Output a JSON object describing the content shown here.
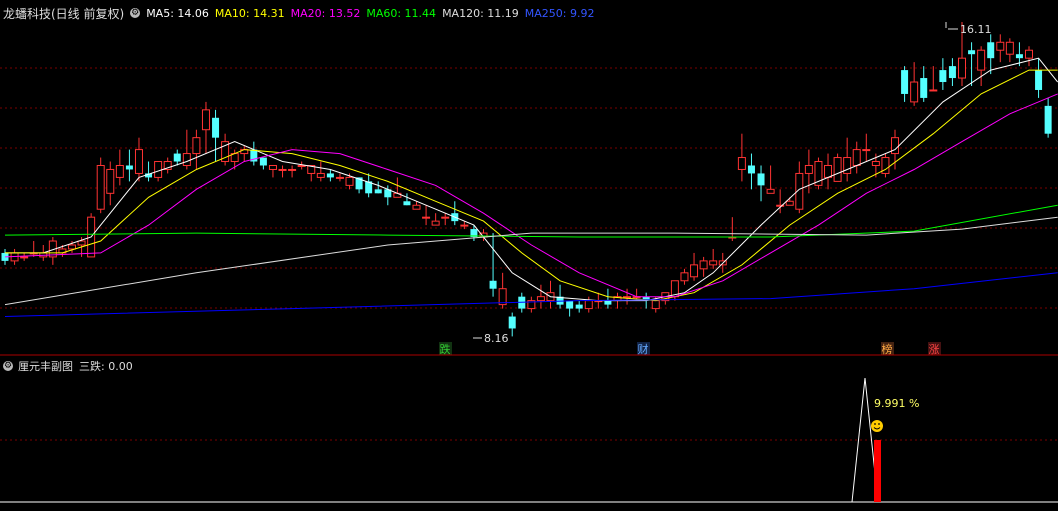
{
  "header": {
    "stock_title": "龙蟠科技(日线 前复权)",
    "ma_legend": [
      {
        "label": "MA5: 14.06",
        "color": "#ffffff"
      },
      {
        "label": "MA10: 14.31",
        "color": "#ffff00"
      },
      {
        "label": "MA20: 13.52",
        "color": "#ff00ff"
      },
      {
        "label": "MA60: 11.44",
        "color": "#00ff00"
      },
      {
        "label": "MA120: 11.19",
        "color": "#dddddd"
      },
      {
        "label": "MA250: 9.92",
        "color": "#0000ff"
      }
    ]
  },
  "sub_panel": {
    "title": "厘元丰副图",
    "indicator": "三跌: 0.00",
    "percent_label": "9.991 %"
  },
  "markers": {
    "high_label": "16.11",
    "low_label": "8.16",
    "tags": [
      {
        "text": "跌",
        "color": "#33cc33",
        "bg": "#113311"
      },
      {
        "text": "财",
        "color": "#66aaff",
        "bg": "#112244"
      },
      {
        "text": "榜",
        "color": "#ffaa44",
        "bg": "#442211"
      },
      {
        "text": "涨",
        "color": "#ff4444",
        "bg": "#441111"
      }
    ]
  },
  "colors": {
    "up": "#ff3333",
    "down": "#54ffff",
    "grid": "#7a0000"
  },
  "chart_data": {
    "type": "candlestick",
    "ylim": [
      7.5,
      16.6
    ],
    "candles": [
      [
        10.3,
        10.1,
        10.4,
        10.0
      ],
      [
        10.1,
        10.3,
        10.4,
        10.0
      ],
      [
        10.2,
        10.2,
        10.3,
        10.1
      ],
      [
        10.3,
        10.3,
        10.6,
        10.2
      ],
      [
        10.2,
        10.3,
        10.5,
        10.1
      ],
      [
        10.2,
        10.6,
        10.7,
        10.0
      ],
      [
        10.3,
        10.4,
        10.5,
        10.2
      ],
      [
        10.4,
        10.5,
        10.6,
        10.3
      ],
      [
        10.5,
        10.6,
        10.7,
        10.2
      ],
      [
        10.2,
        11.2,
        11.3,
        10.2
      ],
      [
        11.4,
        12.5,
        12.7,
        11.3
      ],
      [
        11.8,
        12.4,
        12.6,
        11.5
      ],
      [
        12.2,
        12.5,
        12.9,
        12.0
      ],
      [
        12.5,
        12.4,
        12.9,
        12.1
      ],
      [
        12.3,
        12.9,
        13.2,
        12.1
      ],
      [
        12.3,
        12.2,
        12.6,
        12.1
      ],
      [
        12.2,
        12.6,
        12.6,
        12.1
      ],
      [
        12.4,
        12.6,
        12.7,
        12.3
      ],
      [
        12.8,
        12.6,
        12.9,
        12.5
      ],
      [
        12.5,
        12.8,
        13.4,
        12.4
      ],
      [
        12.8,
        13.2,
        13.4,
        12.4
      ],
      [
        13.4,
        13.9,
        14.1,
        12.8
      ],
      [
        13.7,
        13.2,
        13.9,
        12.6
      ],
      [
        12.6,
        13.1,
        13.3,
        12.5
      ],
      [
        12.6,
        12.8,
        12.9,
        12.4
      ],
      [
        12.8,
        12.9,
        13.0,
        12.6
      ],
      [
        12.9,
        12.6,
        13.1,
        12.5
      ],
      [
        12.7,
        12.5,
        12.7,
        12.4
      ],
      [
        12.4,
        12.5,
        12.5,
        12.2
      ],
      [
        12.4,
        12.4,
        12.5,
        12.2
      ],
      [
        12.4,
        12.4,
        12.5,
        12.2
      ],
      [
        12.5,
        12.5,
        12.6,
        12.4
      ],
      [
        12.3,
        12.5,
        12.5,
        12.1
      ],
      [
        12.2,
        12.3,
        12.6,
        12.1
      ],
      [
        12.3,
        12.2,
        12.4,
        12.1
      ],
      [
        12.2,
        12.2,
        12.3,
        12.1
      ],
      [
        12.0,
        12.2,
        12.3,
        11.9
      ],
      [
        12.2,
        11.9,
        12.2,
        11.8
      ],
      [
        12.1,
        11.8,
        12.3,
        11.7
      ],
      [
        11.9,
        11.8,
        12.1,
        11.8
      ],
      [
        11.9,
        11.7,
        12.0,
        11.5
      ],
      [
        11.7,
        11.8,
        12.2,
        11.7
      ],
      [
        11.6,
        11.5,
        11.8,
        11.5
      ],
      [
        11.4,
        11.5,
        11.6,
        11.4
      ],
      [
        11.2,
        11.2,
        11.5,
        11.0
      ],
      [
        11.0,
        11.1,
        11.3,
        11.0
      ],
      [
        11.2,
        11.2,
        11.3,
        11.0
      ],
      [
        11.3,
        11.1,
        11.6,
        11.0
      ],
      [
        11.0,
        11.0,
        11.1,
        10.9
      ],
      [
        10.9,
        10.7,
        11.0,
        10.6
      ],
      [
        10.7,
        10.8,
        10.9,
        10.6
      ],
      [
        9.6,
        9.4,
        10.8,
        9.2
      ],
      [
        9.0,
        9.4,
        9.8,
        8.9
      ],
      [
        8.7,
        8.4,
        8.8,
        8.2
      ],
      [
        9.2,
        8.9,
        9.3,
        8.8
      ],
      [
        8.9,
        9.1,
        9.2,
        8.8
      ],
      [
        9.1,
        9.2,
        9.5,
        8.9
      ],
      [
        9.1,
        9.3,
        9.6,
        8.9
      ],
      [
        9.2,
        9.0,
        9.5,
        8.9
      ],
      [
        9.1,
        8.9,
        9.1,
        8.7
      ],
      [
        9.0,
        8.9,
        9.1,
        8.8
      ],
      [
        8.9,
        9.1,
        9.2,
        8.8
      ],
      [
        9.1,
        9.1,
        9.3,
        8.9
      ],
      [
        9.1,
        9.0,
        9.4,
        8.9
      ],
      [
        9.1,
        9.2,
        9.3,
        8.9
      ],
      [
        9.2,
        9.2,
        9.4,
        9.0
      ],
      [
        9.2,
        9.2,
        9.4,
        9.1
      ],
      [
        9.2,
        9.1,
        9.3,
        8.9
      ],
      [
        8.9,
        9.1,
        9.2,
        8.8
      ],
      [
        9.1,
        9.3,
        9.3,
        9.0
      ],
      [
        9.2,
        9.6,
        9.6,
        9.1
      ],
      [
        9.6,
        9.8,
        9.9,
        9.5
      ],
      [
        9.7,
        10.0,
        10.3,
        9.6
      ],
      [
        9.9,
        10.1,
        10.2,
        9.7
      ],
      [
        10.0,
        10.1,
        10.4,
        9.9
      ],
      [
        10.0,
        10.1,
        10.3,
        9.8
      ],
      [
        10.7,
        10.7,
        11.2,
        10.6
      ],
      [
        12.4,
        12.7,
        13.3,
        12.1
      ],
      [
        12.5,
        12.3,
        12.8,
        11.9
      ],
      [
        12.3,
        12.0,
        12.5,
        11.6
      ],
      [
        11.8,
        11.9,
        12.5,
        11.8
      ],
      [
        11.5,
        11.5,
        11.9,
        11.3
      ],
      [
        11.5,
        11.6,
        11.7,
        11.5
      ],
      [
        11.4,
        12.3,
        12.6,
        11.3
      ],
      [
        12.3,
        12.5,
        12.9,
        11.8
      ],
      [
        12.0,
        12.6,
        12.7,
        11.9
      ],
      [
        12.2,
        12.5,
        12.8,
        11.9
      ],
      [
        12.1,
        12.7,
        12.8,
        12.1
      ],
      [
        12.3,
        12.7,
        13.2,
        12.1
      ],
      [
        12.5,
        12.9,
        13.1,
        12.3
      ],
      [
        12.9,
        12.9,
        13.3,
        12.6
      ],
      [
        12.5,
        12.6,
        12.8,
        12.2
      ],
      [
        12.3,
        12.7,
        12.8,
        12.2
      ],
      [
        12.8,
        13.2,
        13.4,
        12.4
      ],
      [
        14.9,
        14.3,
        15.0,
        14.1
      ],
      [
        14.1,
        14.6,
        15.1,
        14.0
      ],
      [
        14.7,
        14.2,
        15.0,
        14.1
      ],
      [
        14.4,
        14.4,
        15.0,
        14.4
      ],
      [
        14.9,
        14.6,
        15.2,
        14.4
      ],
      [
        15.0,
        14.7,
        15.2,
        14.5
      ],
      [
        14.7,
        15.2,
        16.11,
        14.5
      ],
      [
        15.4,
        15.3,
        15.6,
        14.5
      ],
      [
        14.9,
        15.4,
        15.5,
        14.5
      ],
      [
        15.6,
        15.2,
        15.8,
        14.8
      ],
      [
        15.4,
        15.6,
        15.8,
        15.1
      ],
      [
        15.3,
        15.6,
        15.7,
        15.1
      ],
      [
        15.3,
        15.2,
        15.6,
        15.0
      ],
      [
        15.2,
        15.4,
        15.5,
        15.0
      ],
      [
        14.9,
        14.4,
        15.2,
        14.2
      ],
      [
        14.0,
        13.3,
        14.2,
        13.2
      ]
    ],
    "ma_series": [
      {
        "name": "MA5",
        "color": "#ffffff",
        "values": [
          [
            0,
            10.3
          ],
          [
            4,
            10.3
          ],
          [
            9,
            10.7
          ],
          [
            14,
            12.2
          ],
          [
            19,
            12.6
          ],
          [
            24,
            13.1
          ],
          [
            29,
            12.6
          ],
          [
            34,
            12.4
          ],
          [
            39,
            12.0
          ],
          [
            44,
            11.5
          ],
          [
            49,
            11.0
          ],
          [
            53,
            9.8
          ],
          [
            57,
            9.2
          ],
          [
            62,
            9.1
          ],
          [
            67,
            9.1
          ],
          [
            71,
            9.3
          ],
          [
            74,
            9.8
          ],
          [
            79,
            11.0
          ],
          [
            83,
            11.9
          ],
          [
            88,
            12.4
          ],
          [
            93,
            12.9
          ],
          [
            98,
            14.1
          ],
          [
            103,
            14.9
          ],
          [
            108,
            15.2
          ],
          [
            110,
            14.6
          ]
        ]
      },
      {
        "name": "MA10",
        "color": "#ffff00",
        "values": [
          [
            0,
            10.3
          ],
          [
            6,
            10.3
          ],
          [
            10,
            10.6
          ],
          [
            15,
            11.7
          ],
          [
            20,
            12.4
          ],
          [
            25,
            12.9
          ],
          [
            30,
            12.8
          ],
          [
            35,
            12.5
          ],
          [
            40,
            12.1
          ],
          [
            45,
            11.6
          ],
          [
            50,
            11.1
          ],
          [
            54,
            10.3
          ],
          [
            58,
            9.6
          ],
          [
            63,
            9.2
          ],
          [
            68,
            9.1
          ],
          [
            72,
            9.3
          ],
          [
            77,
            10.0
          ],
          [
            82,
            11.0
          ],
          [
            87,
            11.8
          ],
          [
            92,
            12.4
          ],
          [
            97,
            13.3
          ],
          [
            102,
            14.3
          ],
          [
            107,
            14.9
          ],
          [
            110,
            14.9
          ]
        ]
      },
      {
        "name": "MA20",
        "color": "#ff00ff",
        "values": [
          [
            0,
            10.2
          ],
          [
            10,
            10.3
          ],
          [
            15,
            11.0
          ],
          [
            20,
            11.9
          ],
          [
            25,
            12.6
          ],
          [
            30,
            12.9
          ],
          [
            35,
            12.8
          ],
          [
            40,
            12.4
          ],
          [
            45,
            12.0
          ],
          [
            50,
            11.3
          ],
          [
            55,
            10.5
          ],
          [
            60,
            9.8
          ],
          [
            66,
            9.2
          ],
          [
            70,
            9.2
          ],
          [
            75,
            9.6
          ],
          [
            80,
            10.3
          ],
          [
            85,
            11.0
          ],
          [
            90,
            11.8
          ],
          [
            95,
            12.4
          ],
          [
            100,
            13.1
          ],
          [
            105,
            13.8
          ],
          [
            110,
            14.3
          ]
        ]
      },
      {
        "name": "MA60",
        "color": "#00ff00",
        "values": [
          [
            0,
            10.75
          ],
          [
            20,
            10.8
          ],
          [
            40,
            10.75
          ],
          [
            60,
            10.7
          ],
          [
            80,
            10.7
          ],
          [
            95,
            10.85
          ],
          [
            110,
            11.5
          ]
        ]
      },
      {
        "name": "MA120",
        "color": "#dddddd",
        "values": [
          [
            0,
            9.0
          ],
          [
            20,
            9.8
          ],
          [
            40,
            10.5
          ],
          [
            55,
            10.8
          ],
          [
            70,
            10.8
          ],
          [
            90,
            10.75
          ],
          [
            100,
            10.9
          ],
          [
            110,
            11.2
          ]
        ]
      },
      {
        "name": "MA250",
        "color": "#0000ff",
        "values": [
          [
            0,
            8.7
          ],
          [
            30,
            8.9
          ],
          [
            60,
            9.1
          ],
          [
            80,
            9.15
          ],
          [
            95,
            9.4
          ],
          [
            110,
            9.8
          ]
        ]
      }
    ],
    "sub_spike": {
      "candle_index": 93,
      "value": 9.991
    }
  }
}
